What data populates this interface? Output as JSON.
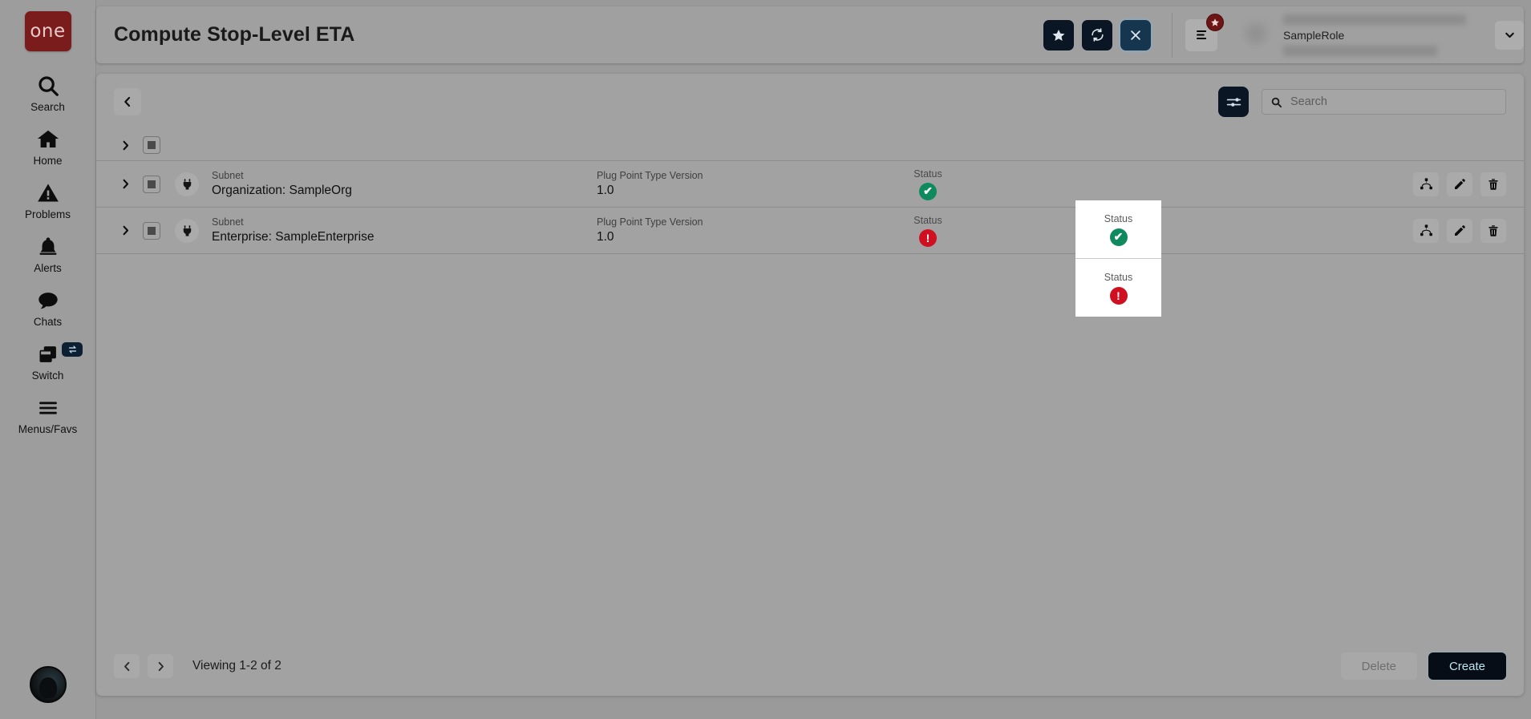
{
  "sidebar": {
    "logo_text": "one",
    "items": [
      {
        "label": "Search",
        "icon": "search-icon"
      },
      {
        "label": "Home",
        "icon": "home-icon"
      },
      {
        "label": "Problems",
        "icon": "warning-triangle-icon"
      },
      {
        "label": "Alerts",
        "icon": "bell-icon"
      },
      {
        "label": "Chats",
        "icon": "chat-bubble-icon"
      },
      {
        "label": "Switch",
        "icon": "switch-windows-icon"
      },
      {
        "label": "Menus/Favs",
        "icon": "hamburger-icon"
      }
    ],
    "avatar": "user-avatar-icon"
  },
  "header": {
    "title": "Compute Stop-Level ETA",
    "actions": [
      {
        "name": "favorite-button",
        "icon": "star-icon"
      },
      {
        "name": "refresh-button",
        "icon": "refresh-icon"
      },
      {
        "name": "close-button",
        "icon": "close-x-icon"
      }
    ],
    "menu_icon": "list-menu-icon",
    "menu_badge_icon": "star-badge-icon",
    "user_role": "SampleRole",
    "user_dropdown_icon": "chevron-down-icon"
  },
  "toolbar": {
    "back_icon": "chevron-left-icon",
    "filter_icon": "filter-sliders-icon",
    "search": {
      "icon": "search-icon",
      "value": "",
      "placeholder": "Search"
    }
  },
  "table": {
    "header_row": {
      "expander_icon": "chevron-right-icon",
      "checkbox_state": "indeterminate"
    },
    "rows": [
      {
        "expander_icon": "chevron-right-icon",
        "type_icon": "plug-icon",
        "name_label": "Subnet",
        "name_value": "Organization: SampleOrg",
        "version_label": "Plug Point Type Version",
        "version_value": "1.0",
        "status_label": "Status",
        "status_state": "ok",
        "status_glyph": "✔",
        "actions": [
          "hierarchy-icon",
          "edit-pencil-icon",
          "delete-trash-icon"
        ]
      },
      {
        "expander_icon": "chevron-right-icon",
        "type_icon": "plug-icon",
        "name_label": "Subnet",
        "name_value": "Enterprise: SampleEnterprise",
        "version_label": "Plug Point Type Version",
        "version_value": "1.0",
        "status_label": "Status",
        "status_state": "error",
        "status_glyph": "!",
        "actions": [
          "hierarchy-icon",
          "edit-pencil-icon",
          "delete-trash-icon"
        ]
      }
    ]
  },
  "footer": {
    "prev_icon": "chevron-left-icon",
    "next_icon": "chevron-right-icon",
    "viewing_text": "Viewing 1-2 of 2",
    "delete_label": "Delete",
    "create_label": "Create"
  },
  "colors": {
    "brand_red": "#7a1c1c",
    "accent_dark": "#0a1624",
    "status_ok": "#0f8a5f",
    "status_error": "#cf1020",
    "page_bg": "#9a9a9a"
  }
}
